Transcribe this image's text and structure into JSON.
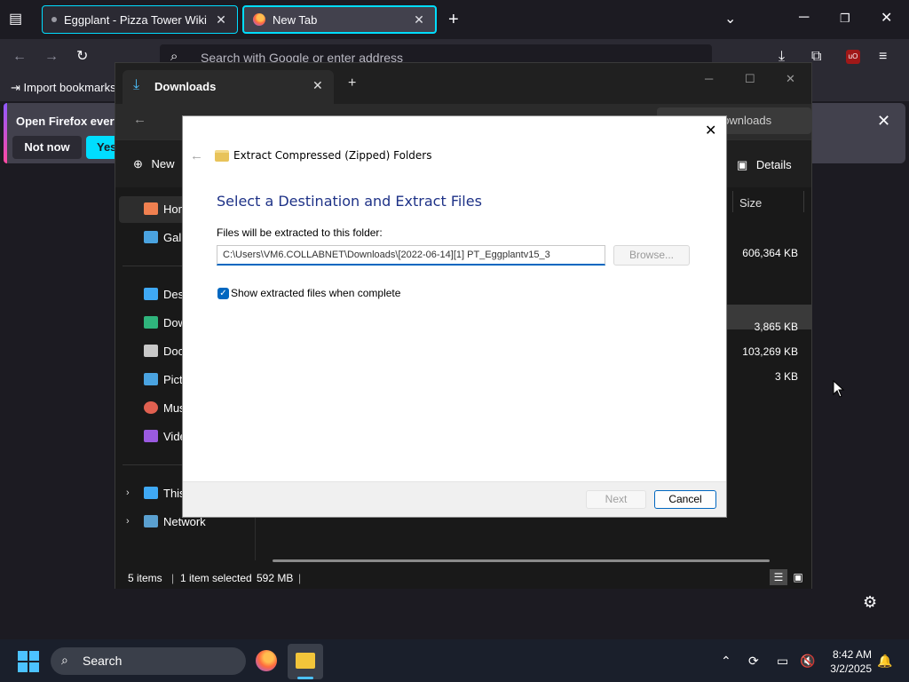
{
  "firefox": {
    "tabs": [
      {
        "title": "Eggplant - Pizza Tower Wiki",
        "close": "✕"
      },
      {
        "title": "New Tab",
        "close": "✕"
      }
    ],
    "url_placeholder": "Search with Google or enter address",
    "bookmarks": {
      "import_label": "Import bookmarks"
    },
    "notification": {
      "text": "Open Firefox every",
      "not_now": "Not now",
      "yes": "Yes,"
    },
    "accent": "#00ddff"
  },
  "explorer": {
    "tab_title": "Downloads",
    "search_placeholder": "Search Downloads",
    "new_label": "New",
    "details_label": "Details",
    "nav_items": [
      "Home",
      "Gallery",
      "Desktop",
      "Downloads",
      "Documents",
      "Pictures",
      "Music",
      "Videos",
      "This PC",
      "Network"
    ],
    "size_header": "Size",
    "sizes": [
      "606,364 KB",
      "3,865 KB",
      "103,269 KB",
      "3 KB"
    ],
    "status": {
      "items": "5 items",
      "selected": "1 item selected",
      "size": "592 MB"
    }
  },
  "dialog": {
    "title": "Extract Compressed (Zipped) Folders",
    "heading": "Select a Destination and Extract Files",
    "folder_label": "Files will be extracted to this folder:",
    "path_value": "C:\\Users\\VM6.COLLABNET\\Downloads\\[2022-06-14][1] PT_Eggplantv15_3",
    "browse_label": "Browse...",
    "checkbox_label": "Show extracted files when complete",
    "checkbox_checked": true,
    "next_label": "Next",
    "cancel_label": "Cancel"
  },
  "taskbar": {
    "search_label": "Search",
    "time": "8:42 AM",
    "date": "3/2/2025"
  }
}
